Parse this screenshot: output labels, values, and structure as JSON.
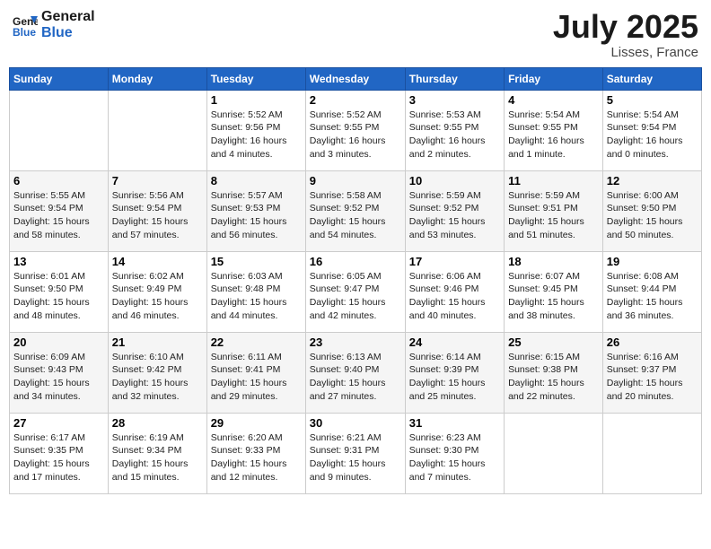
{
  "logo": {
    "line1": "General",
    "line2": "Blue"
  },
  "title": "July 2025",
  "location": "Lisses, France",
  "days_header": [
    "Sunday",
    "Monday",
    "Tuesday",
    "Wednesday",
    "Thursday",
    "Friday",
    "Saturday"
  ],
  "weeks": [
    [
      {
        "num": "",
        "info": ""
      },
      {
        "num": "",
        "info": ""
      },
      {
        "num": "1",
        "info": "Sunrise: 5:52 AM\nSunset: 9:56 PM\nDaylight: 16 hours\nand 4 minutes."
      },
      {
        "num": "2",
        "info": "Sunrise: 5:52 AM\nSunset: 9:55 PM\nDaylight: 16 hours\nand 3 minutes."
      },
      {
        "num": "3",
        "info": "Sunrise: 5:53 AM\nSunset: 9:55 PM\nDaylight: 16 hours\nand 2 minutes."
      },
      {
        "num": "4",
        "info": "Sunrise: 5:54 AM\nSunset: 9:55 PM\nDaylight: 16 hours\nand 1 minute."
      },
      {
        "num": "5",
        "info": "Sunrise: 5:54 AM\nSunset: 9:54 PM\nDaylight: 16 hours\nand 0 minutes."
      }
    ],
    [
      {
        "num": "6",
        "info": "Sunrise: 5:55 AM\nSunset: 9:54 PM\nDaylight: 15 hours\nand 58 minutes."
      },
      {
        "num": "7",
        "info": "Sunrise: 5:56 AM\nSunset: 9:54 PM\nDaylight: 15 hours\nand 57 minutes."
      },
      {
        "num": "8",
        "info": "Sunrise: 5:57 AM\nSunset: 9:53 PM\nDaylight: 15 hours\nand 56 minutes."
      },
      {
        "num": "9",
        "info": "Sunrise: 5:58 AM\nSunset: 9:52 PM\nDaylight: 15 hours\nand 54 minutes."
      },
      {
        "num": "10",
        "info": "Sunrise: 5:59 AM\nSunset: 9:52 PM\nDaylight: 15 hours\nand 53 minutes."
      },
      {
        "num": "11",
        "info": "Sunrise: 5:59 AM\nSunset: 9:51 PM\nDaylight: 15 hours\nand 51 minutes."
      },
      {
        "num": "12",
        "info": "Sunrise: 6:00 AM\nSunset: 9:50 PM\nDaylight: 15 hours\nand 50 minutes."
      }
    ],
    [
      {
        "num": "13",
        "info": "Sunrise: 6:01 AM\nSunset: 9:50 PM\nDaylight: 15 hours\nand 48 minutes."
      },
      {
        "num": "14",
        "info": "Sunrise: 6:02 AM\nSunset: 9:49 PM\nDaylight: 15 hours\nand 46 minutes."
      },
      {
        "num": "15",
        "info": "Sunrise: 6:03 AM\nSunset: 9:48 PM\nDaylight: 15 hours\nand 44 minutes."
      },
      {
        "num": "16",
        "info": "Sunrise: 6:05 AM\nSunset: 9:47 PM\nDaylight: 15 hours\nand 42 minutes."
      },
      {
        "num": "17",
        "info": "Sunrise: 6:06 AM\nSunset: 9:46 PM\nDaylight: 15 hours\nand 40 minutes."
      },
      {
        "num": "18",
        "info": "Sunrise: 6:07 AM\nSunset: 9:45 PM\nDaylight: 15 hours\nand 38 minutes."
      },
      {
        "num": "19",
        "info": "Sunrise: 6:08 AM\nSunset: 9:44 PM\nDaylight: 15 hours\nand 36 minutes."
      }
    ],
    [
      {
        "num": "20",
        "info": "Sunrise: 6:09 AM\nSunset: 9:43 PM\nDaylight: 15 hours\nand 34 minutes."
      },
      {
        "num": "21",
        "info": "Sunrise: 6:10 AM\nSunset: 9:42 PM\nDaylight: 15 hours\nand 32 minutes."
      },
      {
        "num": "22",
        "info": "Sunrise: 6:11 AM\nSunset: 9:41 PM\nDaylight: 15 hours\nand 29 minutes."
      },
      {
        "num": "23",
        "info": "Sunrise: 6:13 AM\nSunset: 9:40 PM\nDaylight: 15 hours\nand 27 minutes."
      },
      {
        "num": "24",
        "info": "Sunrise: 6:14 AM\nSunset: 9:39 PM\nDaylight: 15 hours\nand 25 minutes."
      },
      {
        "num": "25",
        "info": "Sunrise: 6:15 AM\nSunset: 9:38 PM\nDaylight: 15 hours\nand 22 minutes."
      },
      {
        "num": "26",
        "info": "Sunrise: 6:16 AM\nSunset: 9:37 PM\nDaylight: 15 hours\nand 20 minutes."
      }
    ],
    [
      {
        "num": "27",
        "info": "Sunrise: 6:17 AM\nSunset: 9:35 PM\nDaylight: 15 hours\nand 17 minutes."
      },
      {
        "num": "28",
        "info": "Sunrise: 6:19 AM\nSunset: 9:34 PM\nDaylight: 15 hours\nand 15 minutes."
      },
      {
        "num": "29",
        "info": "Sunrise: 6:20 AM\nSunset: 9:33 PM\nDaylight: 15 hours\nand 12 minutes."
      },
      {
        "num": "30",
        "info": "Sunrise: 6:21 AM\nSunset: 9:31 PM\nDaylight: 15 hours\nand 9 minutes."
      },
      {
        "num": "31",
        "info": "Sunrise: 6:23 AM\nSunset: 9:30 PM\nDaylight: 15 hours\nand 7 minutes."
      },
      {
        "num": "",
        "info": ""
      },
      {
        "num": "",
        "info": ""
      }
    ]
  ]
}
